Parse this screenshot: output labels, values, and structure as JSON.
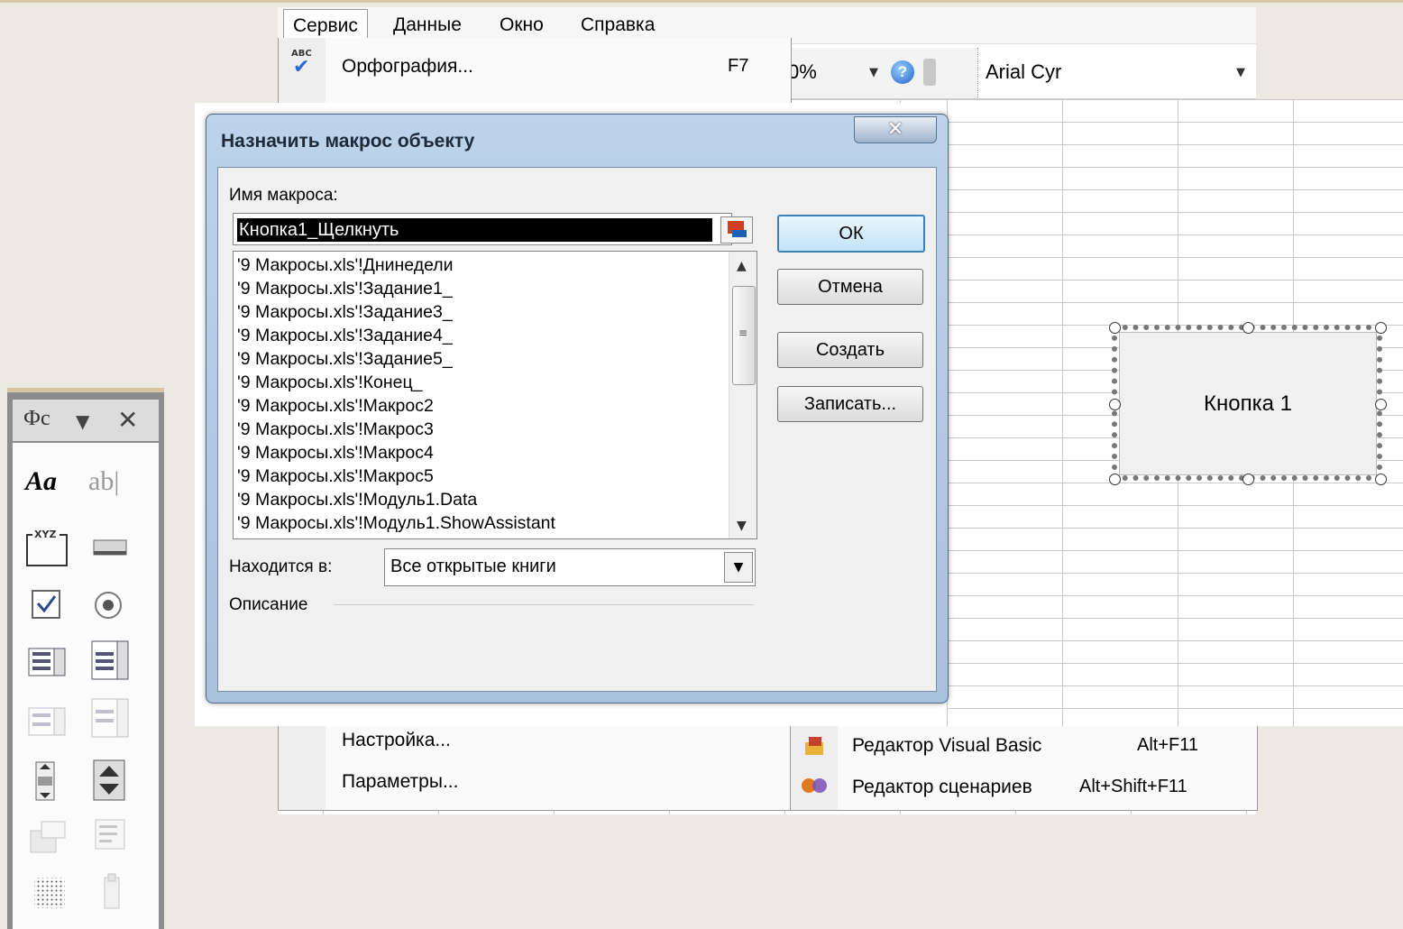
{
  "menubar": {
    "items": [
      {
        "label": "Сервис",
        "active": true
      },
      {
        "label": "Данные",
        "active": false
      },
      {
        "label": "Окно",
        "active": false
      },
      {
        "label": "Справка",
        "active": false
      }
    ]
  },
  "toolbar": {
    "zoom": "0%",
    "font_name": "Arial Cyr"
  },
  "service_menu": {
    "spelling": {
      "label": "Орфография...",
      "shortcut": "F7"
    },
    "customize": {
      "label": "Настройка..."
    },
    "options": {
      "label": "Параметры..."
    }
  },
  "macro_submenu": {
    "vb_editor": {
      "label": "Редактор Visual Basic",
      "shortcut": "Alt+F11"
    },
    "script_editor": {
      "label": "Редактор сценариев",
      "shortcut": "Alt+Shift+F11"
    }
  },
  "dialog": {
    "title": "Назначить макрос объекту",
    "close_label": "×",
    "macro_name_label": "Имя макроса:",
    "macro_name_value": "Кнопка1_Щелкнуть",
    "macros": [
      "'9 Макросы.xls'!Днинедели",
      "'9 Макросы.xls'!Задание1_",
      "'9 Макросы.xls'!Задание3_",
      "'9 Макросы.xls'!Задание4_",
      "'9 Макросы.xls'!Задание5_",
      "'9 Макросы.xls'!Конец_",
      "'9 Макросы.xls'!Макрос2",
      "'9 Макросы.xls'!Макрос3",
      "'9 Макросы.xls'!Макрос4",
      "'9 Макросы.xls'!Макрос5",
      "'9 Макросы.xls'!Модуль1.Data",
      "'9 Макросы.xls'!Модуль1.ShowAssistant"
    ],
    "location_label": "Находится в:",
    "location_value": "Все открытые книги",
    "description_label": "Описание",
    "buttons": {
      "ok": "ОК",
      "cancel": "Отмена",
      "create": "Создать",
      "record": "Записать..."
    }
  },
  "sheet_button": {
    "label": "Кнопка 1"
  },
  "forms_toolbar": {
    "title": "Фс",
    "icons": [
      "label-icon",
      "edit-box-icon",
      "group-box-icon",
      "button-icon",
      "checkbox-icon",
      "option-button-icon",
      "list-box-icon",
      "combo-box-icon",
      "combo-list-edit-icon",
      "combo-dropdown-edit-icon",
      "scroll-bar-icon",
      "spinner-icon",
      "control-properties-icon",
      "edit-code-icon",
      "toggle-grid-icon",
      "run-dialog-icon"
    ]
  }
}
